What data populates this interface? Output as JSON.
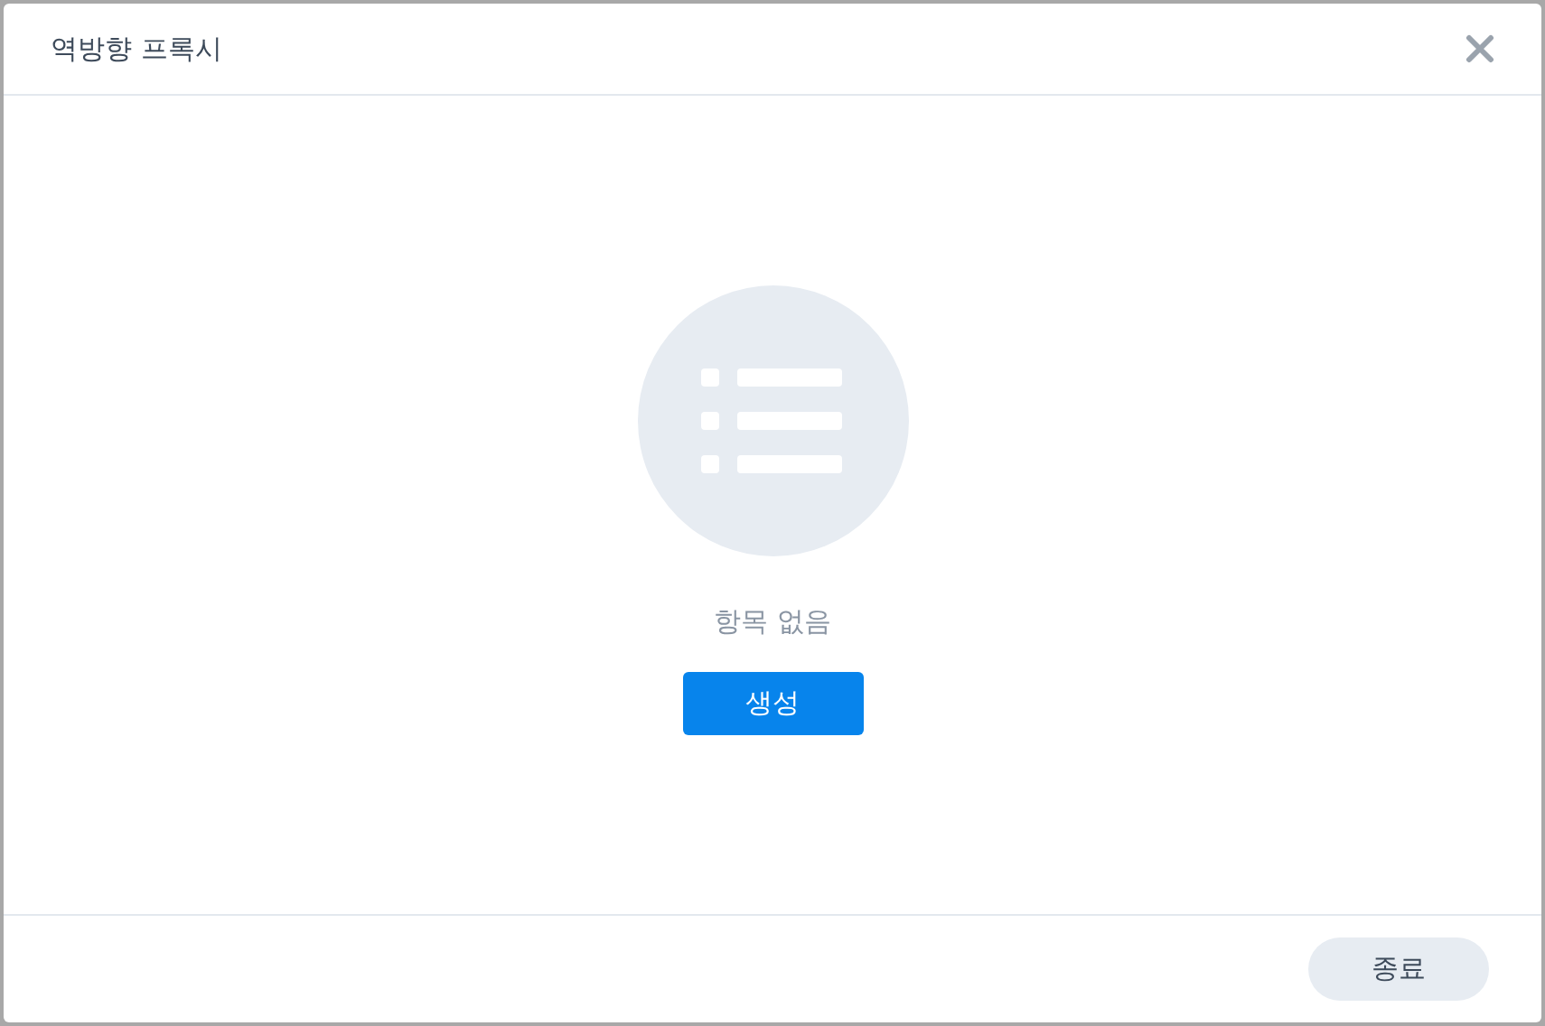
{
  "dialog": {
    "title": "역방향 프록시"
  },
  "empty_state": {
    "message": "항목 없음",
    "create_button": "생성"
  },
  "footer": {
    "buttons": [
      "종료"
    ]
  }
}
